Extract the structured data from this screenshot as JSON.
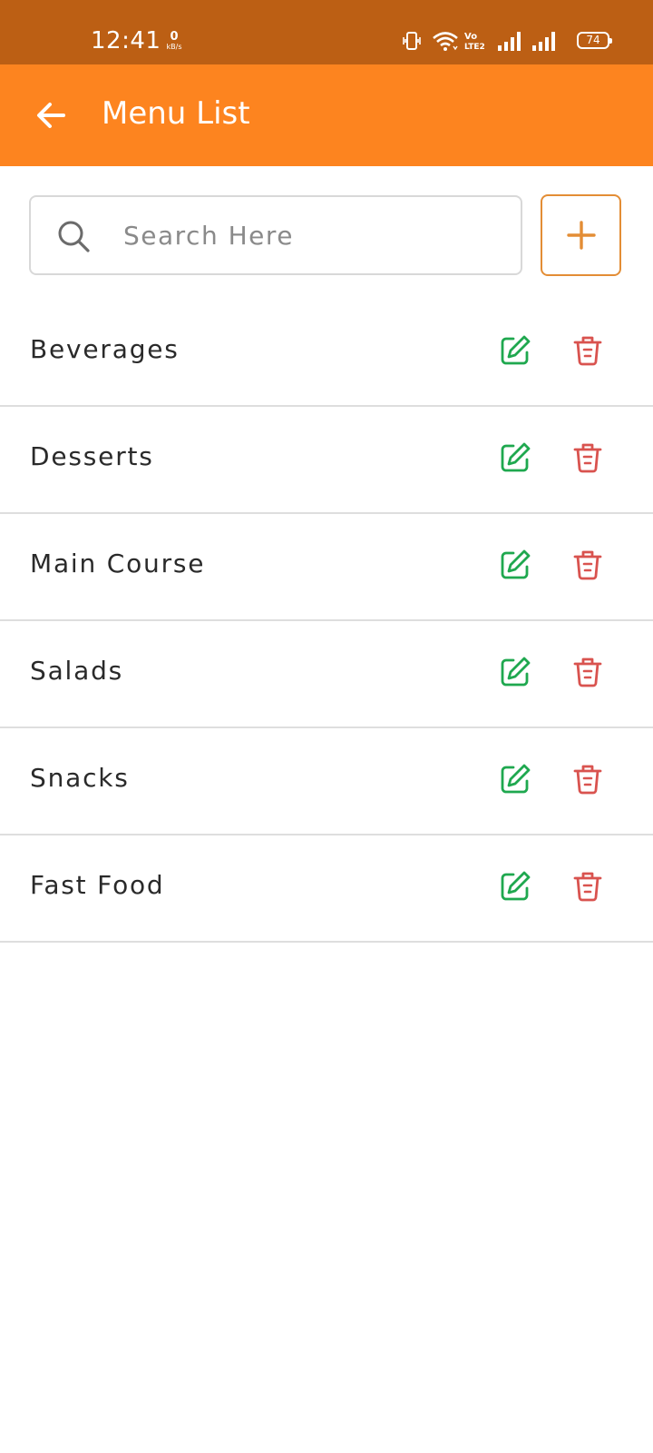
{
  "status_bar": {
    "time": "12:41",
    "net_speed_value": "0",
    "net_speed_unit": "kB/s",
    "volte_label": "Vo LTE2",
    "battery": "74",
    "background_color": "#bc5f14"
  },
  "app_bar": {
    "title": "Menu List",
    "back_icon": "arrow-left-icon",
    "background_color": "#fd841f"
  },
  "search": {
    "placeholder": "Search Here",
    "value": "",
    "icon": "search-icon"
  },
  "add_button": {
    "icon": "plus-icon",
    "accent_color": "#e38d35"
  },
  "menu_list": {
    "edit_icon": "edit-icon",
    "delete_icon": "trash-icon",
    "edit_color": "#1fa84f",
    "delete_color": "#d9534f",
    "items": [
      {
        "label": "Beverages"
      },
      {
        "label": "Desserts"
      },
      {
        "label": "Main Course"
      },
      {
        "label": "Salads"
      },
      {
        "label": "Snacks"
      },
      {
        "label": "Fast Food"
      }
    ]
  }
}
